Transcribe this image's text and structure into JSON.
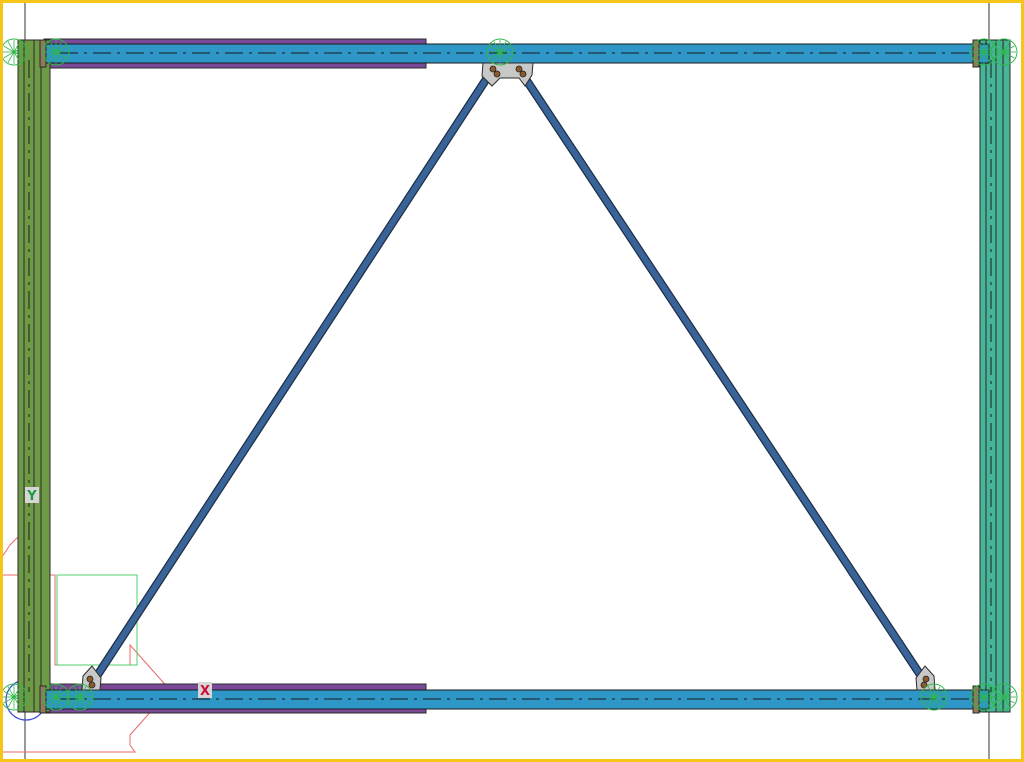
{
  "viewport": {
    "frame_color": "#f5c518",
    "background": "#ffffff"
  },
  "axes": {
    "x_label": "X",
    "y_label": "Y",
    "x_color": "#d0103a",
    "y_color": "#1e9a45",
    "label_bg": "#d6d6d6"
  },
  "members": {
    "top_beam": {
      "type": "beam",
      "color": "#2e97c8"
    },
    "bottom_beam": {
      "type": "beam",
      "color": "#2e97c8"
    },
    "left_column": {
      "type": "column",
      "color": "#6f9a45"
    },
    "right_column": {
      "type": "column",
      "color": "#46b59a"
    },
    "brace_left": {
      "type": "brace",
      "color": "#3a6497"
    },
    "brace_right": {
      "type": "brace",
      "color": "#3a6497"
    },
    "top_left_segment": {
      "type": "beam",
      "color": "#7a4a98"
    },
    "bottom_left_segment": {
      "type": "beam",
      "color": "#7a4a98"
    }
  },
  "icons": {
    "connection_marker": "green-radial-connection-icon",
    "gusset_plate": "gusset-plate-icon",
    "ucs_origin": "ucs-origin-icon"
  }
}
